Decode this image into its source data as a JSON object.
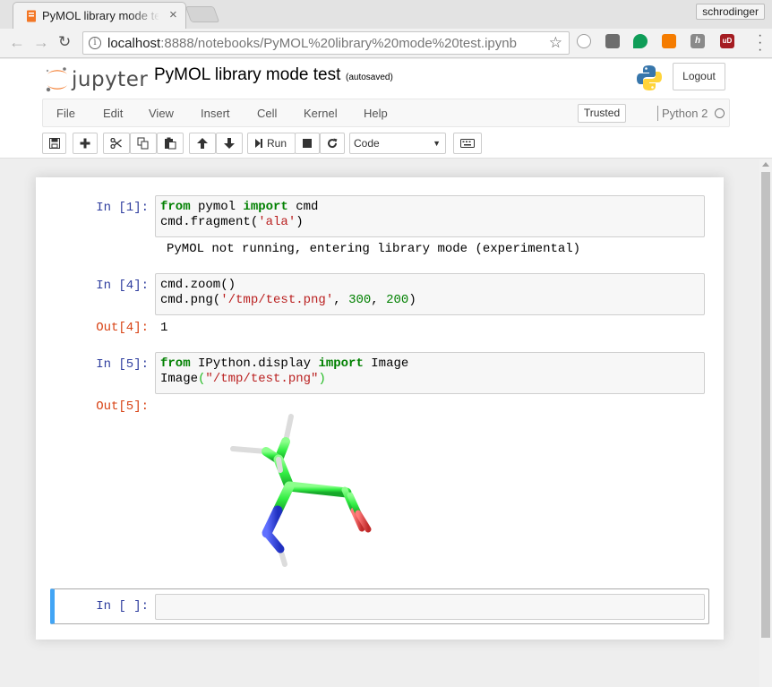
{
  "browser": {
    "tab_title": "PyMOL library mode test",
    "close_glyph": "×",
    "profile_name": "schrodinger",
    "url_host": "localhost",
    "url_path": ":8888/notebooks/PyMOL%20library%20mode%20test.ipynb",
    "back_glyph": "←",
    "forward_glyph": "→",
    "reload_glyph": "↻",
    "star_glyph": "☆",
    "info_glyph": "i",
    "extensions": [
      {
        "name": "grey-ext-icon",
        "glyph": "",
        "color": "#9e9e9e"
      },
      {
        "name": "pocket-ext-icon",
        "glyph": "",
        "color": "#6d6d6d"
      },
      {
        "name": "green-drop-ext-icon",
        "glyph": "",
        "color": "#0f9d58"
      },
      {
        "name": "rss-ext-icon",
        "glyph": "",
        "color": "#f57c00"
      },
      {
        "name": "h-ext-icon",
        "glyph": "h",
        "color": "#8a8a8a"
      },
      {
        "name": "ublock-ext-icon",
        "glyph": "uD",
        "color": "#a51d22"
      }
    ]
  },
  "jupyter": {
    "logo_text": "jupyter",
    "notebook_title": "PyMOL library mode test",
    "autosave_status": "(autosaved)",
    "logout_label": "Logout",
    "menu": [
      "File",
      "Edit",
      "View",
      "Insert",
      "Cell",
      "Kernel",
      "Help"
    ],
    "trusted_label": "Trusted",
    "kernel_name": "Python 2",
    "run_label": "Run",
    "cell_type": "Code",
    "select_caret": "▼"
  },
  "cells": [
    {
      "prompt": "In [1]:",
      "lines": [
        [
          [
            "kw",
            "from"
          ],
          [
            "plain",
            " pymol "
          ],
          [
            "kw",
            "import"
          ],
          [
            "plain",
            " cmd"
          ]
        ],
        [
          [
            "plain",
            "cmd.fragment("
          ],
          [
            "str",
            "'ala'"
          ],
          [
            "plain",
            ")"
          ]
        ]
      ],
      "output_text": "PyMOL not running, entering library mode (experimental)"
    },
    {
      "prompt": "In [4]:",
      "lines": [
        [
          [
            "plain",
            "cmd.zoom()"
          ]
        ],
        [
          [
            "plain",
            "cmd.png("
          ],
          [
            "str",
            "'/tmp/test.png'"
          ],
          [
            "plain",
            ", "
          ],
          [
            "num",
            "300"
          ],
          [
            "plain",
            ", "
          ],
          [
            "num",
            "200"
          ],
          [
            "plain",
            ")"
          ]
        ]
      ],
      "out_prompt": "Out[4]:",
      "output_text": "1"
    },
    {
      "prompt": "In [5]:",
      "lines": [
        [
          [
            "kw",
            "from"
          ],
          [
            "plain",
            " IPython.display "
          ],
          [
            "kw",
            "import"
          ],
          [
            "plain",
            " Image"
          ]
        ],
        [
          [
            "plain",
            "Image"
          ],
          [
            "bracket",
            "("
          ],
          [
            "str",
            "\"/tmp/test.png\""
          ],
          [
            "bracket",
            ")"
          ]
        ]
      ],
      "out_prompt": "Out[5]:"
    },
    {
      "prompt": "In [ ]:"
    }
  ],
  "colors": {
    "prompt_in": "#303f9f",
    "prompt_out": "#d84315",
    "active_cell_border": "#42a5f5",
    "carbon": "#33ee44",
    "nitrogen": "#3344ee",
    "oxygen": "#e04444",
    "hydrogen": "#e8e8e8"
  }
}
